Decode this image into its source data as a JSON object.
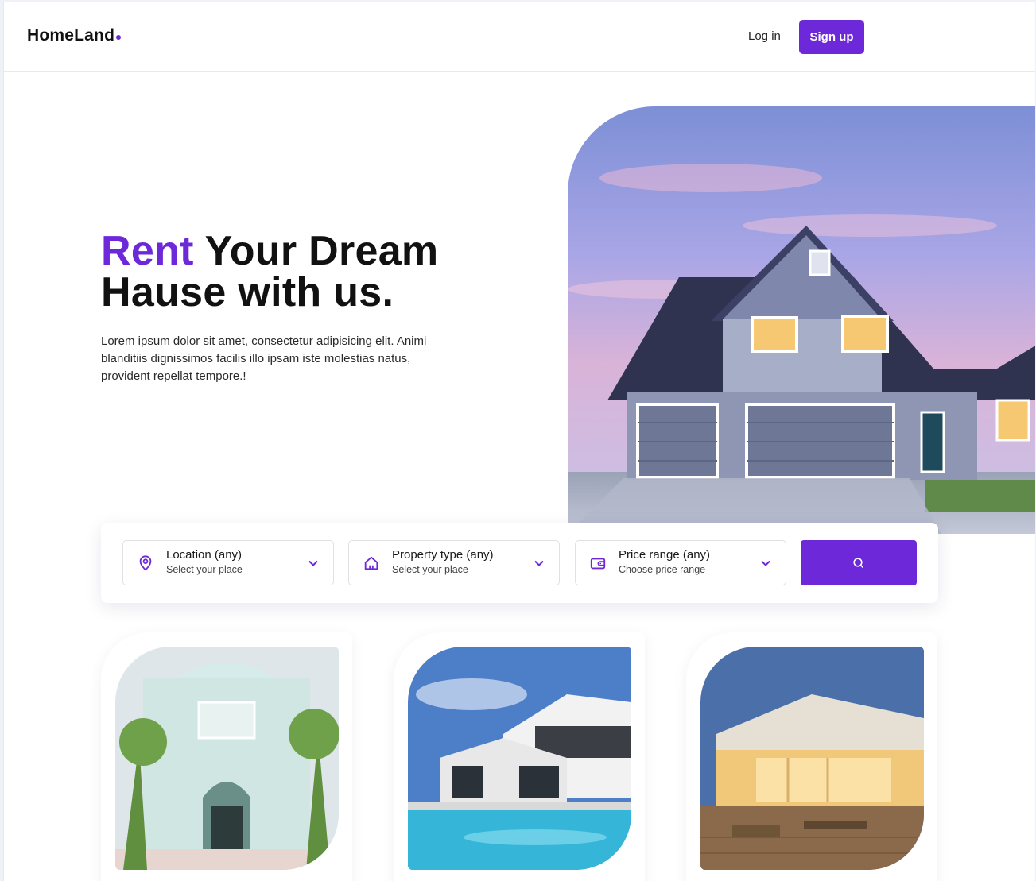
{
  "header": {
    "logo": "HomeLand",
    "login_label": "Log in",
    "signup_label": "Sign up"
  },
  "hero": {
    "title_accent": "Rent",
    "title_rest": " Your Dream Hause with us.",
    "description": "Lorem ipsum dolor sit amet, consectetur adipisicing elit. Animi blanditiis dignissimos facilis illo ipsam iste molestias natus, provident repellat tempore.!"
  },
  "search": {
    "filters": [
      {
        "title": "Location (any)",
        "subtitle": "Select your place",
        "icon": "map-pin-icon"
      },
      {
        "title": "Property type (any)",
        "subtitle": "Select your place",
        "icon": "home-icon"
      },
      {
        "title": "Price range (any)",
        "subtitle": "Choose price range",
        "icon": "wallet-icon"
      }
    ],
    "button_icon": "search-icon"
  },
  "colors": {
    "accent": "#6d28d9",
    "text": "#111111"
  }
}
